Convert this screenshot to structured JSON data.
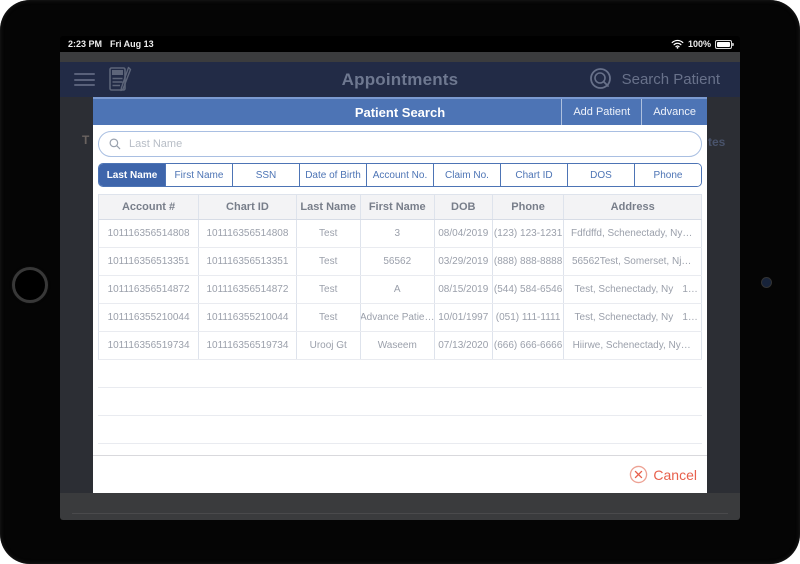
{
  "status_bar": {
    "time": "2:23 PM",
    "date": "Fri Aug 13",
    "battery_percent": "100%",
    "wifi_icon": "wifi-icon",
    "battery_icon": "battery-icon"
  },
  "nav_bar": {
    "title": "Appointments",
    "menu_icon": "hamburger-icon",
    "compose_icon": "note-edit-icon",
    "search_icon": "magnifier-icon",
    "search_patient_label": "Search Patient"
  },
  "background": {
    "left_fragment": "T",
    "right_fragment": "tes"
  },
  "modal": {
    "title": "Patient Search",
    "header_buttons": {
      "add_patient": "Add Patient",
      "advance": "Advance"
    },
    "search": {
      "placeholder": "Last Name",
      "value": "",
      "icon": "magnifier-icon"
    },
    "filter_tabs": [
      {
        "label": "Last Name",
        "selected": true
      },
      {
        "label": "First Name",
        "selected": false
      },
      {
        "label": "SSN",
        "selected": false
      },
      {
        "label": "Date of Birth",
        "selected": false
      },
      {
        "label": "Account No.",
        "selected": false
      },
      {
        "label": "Claim No.",
        "selected": false
      },
      {
        "label": "Chart ID",
        "selected": false
      },
      {
        "label": "DOS",
        "selected": false
      },
      {
        "label": "Phone",
        "selected": false
      }
    ],
    "table": {
      "columns": [
        "Account #",
        "Chart ID",
        "Last Name",
        "First Name",
        "DOB",
        "Phone",
        "Address"
      ],
      "rows": [
        {
          "account": "101116356514808",
          "chart": "101116356514808",
          "last": "Test",
          "first": "3",
          "dob": "08/04/2019",
          "phone": "(123) 123-1231",
          "address": "Fdfdffd, Schenectady, Ny…",
          "address_tail": ""
        },
        {
          "account": "101116356513351",
          "chart": "101116356513351",
          "last": "Test",
          "first": "56562",
          "dob": "03/29/2019",
          "phone": "(888) 888-8888",
          "address": "56562Test, Somerset, Nj…",
          "address_tail": ""
        },
        {
          "account": "101116356514872",
          "chart": "101116356514872",
          "last": "Test",
          "first": "A",
          "dob": "08/15/2019",
          "phone": "(544) 584-6546",
          "address": "Test, Schenectady, Ny",
          "address_tail": "1…"
        },
        {
          "account": "101116355210044",
          "chart": "101116355210044",
          "last": "Test",
          "first": "Advance Patie…",
          "dob": "10/01/1997",
          "phone": "(051) 111-1111",
          "address": "Test, Schenectady, Ny",
          "address_tail": "1…"
        },
        {
          "account": "101116356519734",
          "chart": "101116356519734",
          "last": "Urooj Gt",
          "first": "Waseem",
          "dob": "07/13/2020",
          "phone": "(666) 666-6666",
          "address": "Hiirwe, Schenectady, Ny…",
          "address_tail": ""
        }
      ]
    },
    "footer": {
      "cancel_label": "Cancel",
      "cancel_icon": "circle-x-icon"
    }
  },
  "colors": {
    "modal_header_blue": "#4d74b5",
    "selected_tab_blue": "#3e65ab",
    "cancel_orange": "#e8604c",
    "table_header_bg": "#f3f3f5",
    "nav_bar_bg": "#222b46"
  }
}
